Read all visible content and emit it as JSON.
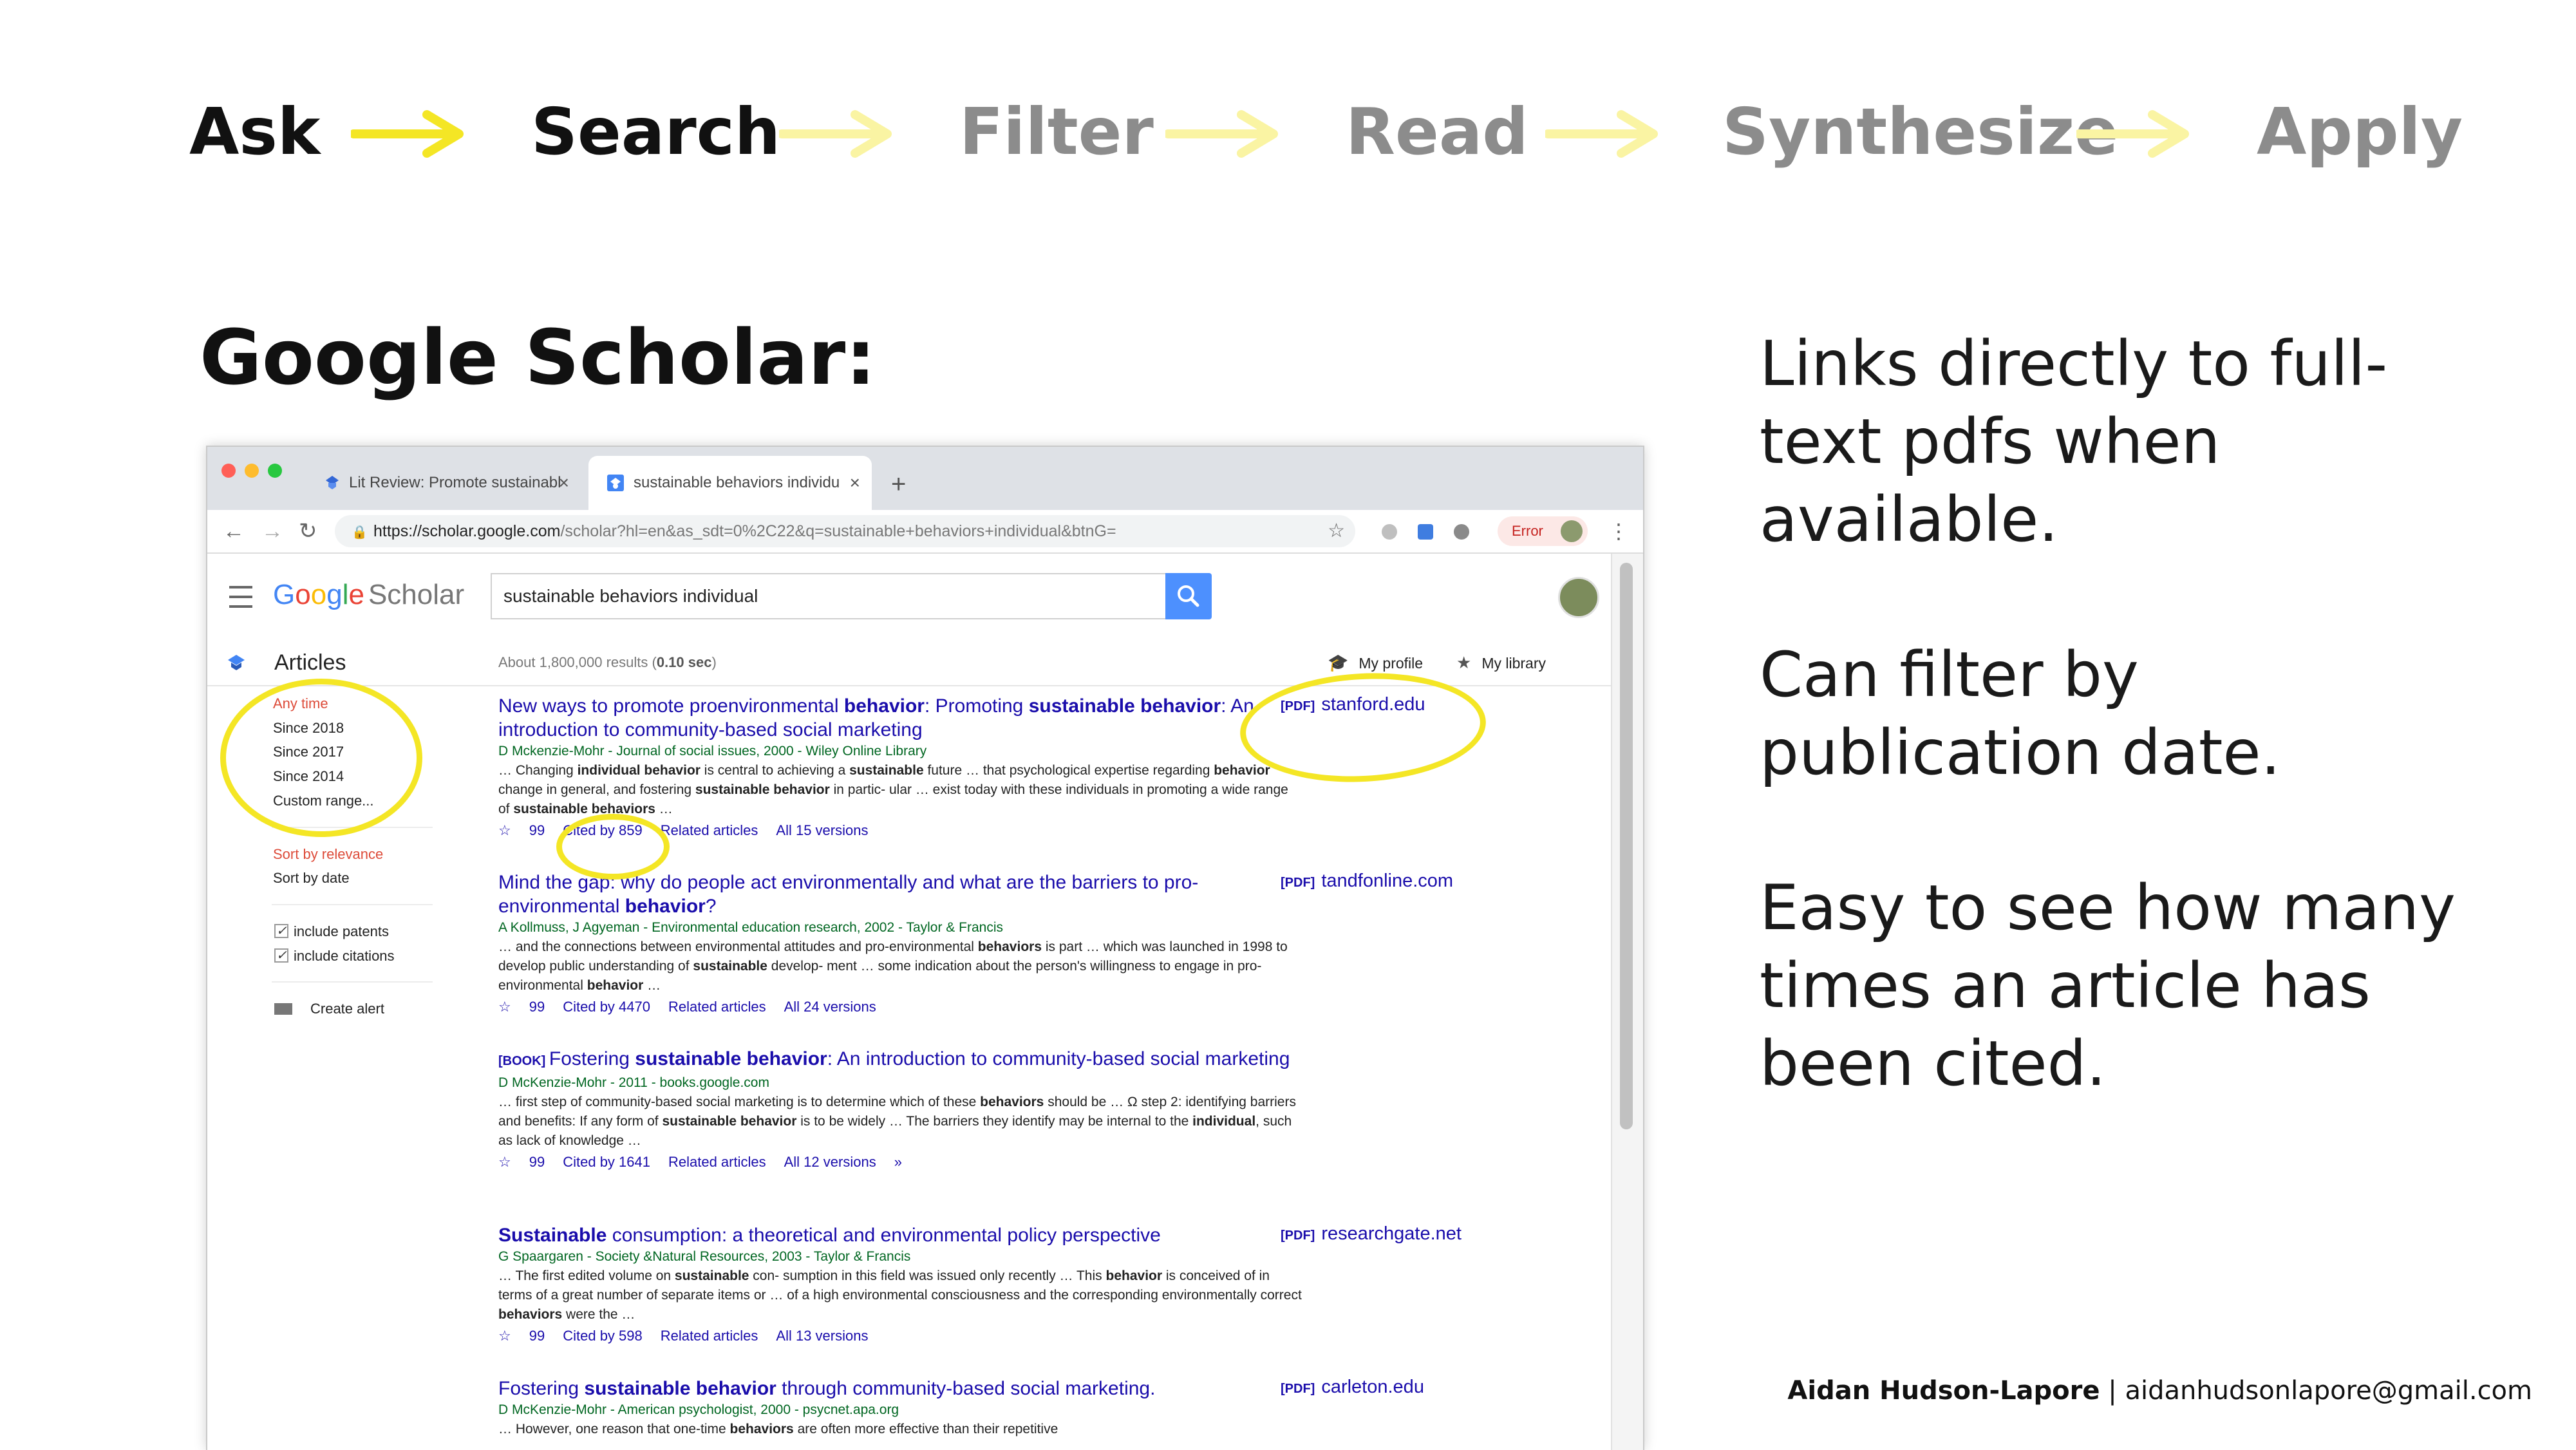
{
  "process_steps": [
    {
      "label": "Ask",
      "active": true
    },
    {
      "label": "Search",
      "active": true
    },
    {
      "label": "Filter",
      "active": false
    },
    {
      "label": "Read",
      "active": false
    },
    {
      "label": "Synthesize",
      "active": false
    },
    {
      "label": "Apply",
      "active": false
    }
  ],
  "colors": {
    "accent_yellow": "#f4e625",
    "arrow_faded": "#faf4a3",
    "link_blue": "#1a0dab",
    "meta_green": "#006621",
    "filter_red": "#dd4b39"
  },
  "slide": {
    "title": "Google Scholar:",
    "bullets": [
      "Links directly to full-text pdfs when available.",
      "Can filter by publication date.",
      "Easy to see how many times an article has been cited."
    ],
    "footer": {
      "name": "Aidan Hudson-Lapore",
      "separator": "|",
      "email": "aidanhudsonlapore@gmail.com"
    }
  },
  "browser": {
    "tabs": [
      {
        "title": "Lit Review: Promote sustainabl",
        "icon": "bookmark-icon",
        "active": false
      },
      {
        "title": "sustainable behaviors individu",
        "icon": "scholar-favicon-icon",
        "active": true
      }
    ],
    "new_tab": "+",
    "url_host": "https://scholar.google.com",
    "url_rest": "/scholar?hl=en&as_sdt=0%2C22&q=sustainable+behaviors+individual&btnG=",
    "error_label": "Error"
  },
  "scholar": {
    "logo_google": [
      "G",
      "o",
      "o",
      "g",
      "l",
      "e"
    ],
    "logo_scholar": "Scholar",
    "query": "sustainable behaviors individual",
    "section": "Articles",
    "result_count_prefix": "About 1,800,000 results (",
    "result_time": "0.10 sec",
    "result_count_suffix": ")",
    "my_profile": "My profile",
    "my_library": "My library",
    "time_filters": [
      "Any time",
      "Since 2018",
      "Since 2017",
      "Since 2014",
      "Custom range..."
    ],
    "sort_options": [
      "Sort by relevance",
      "Sort by date"
    ],
    "checkboxes": [
      "include patents",
      "include citations"
    ],
    "create_alert": "Create alert",
    "results": [
      {
        "tag": "",
        "title_parts": [
          [
            "New ways to promote proenvironmental ",
            false
          ],
          [
            "behavior",
            true
          ],
          [
            ": Promoting ",
            false
          ],
          [
            "sustainable",
            true
          ],
          [
            " ",
            false
          ],
          [
            "behavior",
            true
          ],
          [
            ": An introduction to community-based social marketing",
            false
          ]
        ],
        "meta": "D Mckenzie-Mohr - Journal of social issues, 2000 - Wiley Online Library",
        "snippet_parts": [
          [
            "… Changing ",
            false
          ],
          [
            "individual behavior",
            true
          ],
          [
            " is central to achieving a ",
            false
          ],
          [
            "sustainable",
            true
          ],
          [
            " future … that psychological expertise regarding ",
            false
          ],
          [
            "behavior",
            true
          ],
          [
            " change in general, and fostering ",
            false
          ],
          [
            "sustainable behavior",
            true
          ],
          [
            " in partic- ular … exist today with these individuals in promoting a wide range of ",
            false
          ],
          [
            "sustainable behaviors",
            true
          ],
          [
            " …",
            false
          ]
        ],
        "cited_by": "Cited by 859",
        "related": "Related articles",
        "versions": "All 15 versions",
        "pdf_tag": "[PDF]",
        "pdf_source": "stanford.edu"
      },
      {
        "tag": "",
        "title_parts": [
          [
            "Mind the gap: why do people act environmentally and what are the barriers to pro-environmental ",
            false
          ],
          [
            "behavior",
            true
          ],
          [
            "?",
            false
          ]
        ],
        "meta": "A Kollmuss, J Agyeman - Environmental education research, 2002 - Taylor & Francis",
        "snippet_parts": [
          [
            "… and the connections between environmental attitudes and pro-environmental ",
            false
          ],
          [
            "behaviors",
            true
          ],
          [
            " is part … which was launched in 1998 to develop public understanding of ",
            false
          ],
          [
            "sustainable",
            true
          ],
          [
            " develop- ment … some indication about the person's willingness to engage in pro- environmental ",
            false
          ],
          [
            "behavior",
            true
          ],
          [
            " …",
            false
          ]
        ],
        "cited_by": "Cited by 4470",
        "related": "Related articles",
        "versions": "All 24 versions",
        "pdf_tag": "[PDF]",
        "pdf_source": "tandfonline.com"
      },
      {
        "tag": "[BOOK]",
        "title_parts": [
          [
            "Fostering ",
            false
          ],
          [
            "sustainable behavior",
            true
          ],
          [
            ": An introduction to community-based social marketing",
            false
          ]
        ],
        "meta": "D McKenzie-Mohr - 2011 - books.google.com",
        "snippet_parts": [
          [
            "… first step of community-based social marketing is to determine which of these ",
            false
          ],
          [
            "behaviors",
            true
          ],
          [
            " should be … Ω step 2: identifying barriers and benefits: If any form of ",
            false
          ],
          [
            "sustainable behavior",
            true
          ],
          [
            " is to be widely … The barriers they identify may be internal to the ",
            false
          ],
          [
            "individual",
            true
          ],
          [
            ", such as lack of knowledge …",
            false
          ]
        ],
        "cited_by": "Cited by 1641",
        "related": "Related articles",
        "versions": "All 12 versions",
        "pdf_tag": "",
        "pdf_source": ""
      },
      {
        "tag": "",
        "title_parts": [
          [
            "Sustainable",
            true
          ],
          [
            " consumption: a theoretical and environmental policy perspective",
            false
          ]
        ],
        "meta": "G Spaargaren - Society &Natural Resources, 2003 - Taylor & Francis",
        "snippet_parts": [
          [
            "… The first edited volume on ",
            false
          ],
          [
            "sustainable",
            true
          ],
          [
            " con- sumption in this field was issued only recently … This ",
            false
          ],
          [
            "behavior",
            true
          ],
          [
            " is conceived of in terms of a great number of separate items or … of a high environmental consciousness and the corresponding environmentally correct ",
            false
          ],
          [
            "behaviors",
            true
          ],
          [
            " were the …",
            false
          ]
        ],
        "cited_by": "Cited by 598",
        "related": "Related articles",
        "versions": "All 13 versions",
        "pdf_tag": "[PDF]",
        "pdf_source": "researchgate.net"
      },
      {
        "tag": "",
        "title_parts": [
          [
            "Fostering ",
            false
          ],
          [
            "sustainable behavior",
            true
          ],
          [
            " through community-based social marketing.",
            false
          ]
        ],
        "meta": "D McKenzie-Mohr - American psychologist, 2000 - psycnet.apa.org",
        "snippet_parts": [
          [
            "… However, one reason that one-time ",
            false
          ],
          [
            "behaviors",
            true
          ],
          [
            " are often more effective than their repetitive",
            false
          ]
        ],
        "cited_by": "",
        "related": "",
        "versions": "",
        "pdf_tag": "[PDF]",
        "pdf_source": "carleton.edu"
      }
    ]
  }
}
